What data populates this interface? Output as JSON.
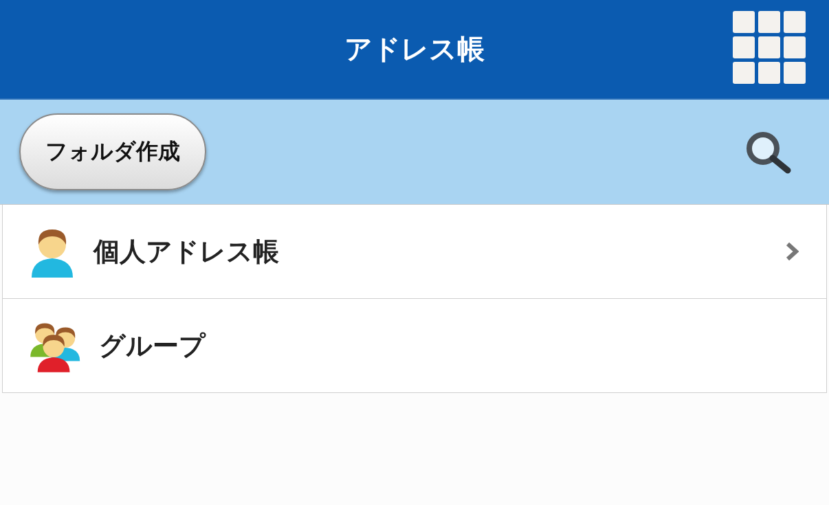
{
  "header": {
    "title": "アドレス帳"
  },
  "toolbar": {
    "button": "フォルダ作成"
  },
  "items": [
    {
      "kind": "person",
      "label": "個人アドレス帳",
      "chevron": true
    },
    {
      "kind": "group",
      "label": "グループ",
      "chevron": false
    }
  ]
}
